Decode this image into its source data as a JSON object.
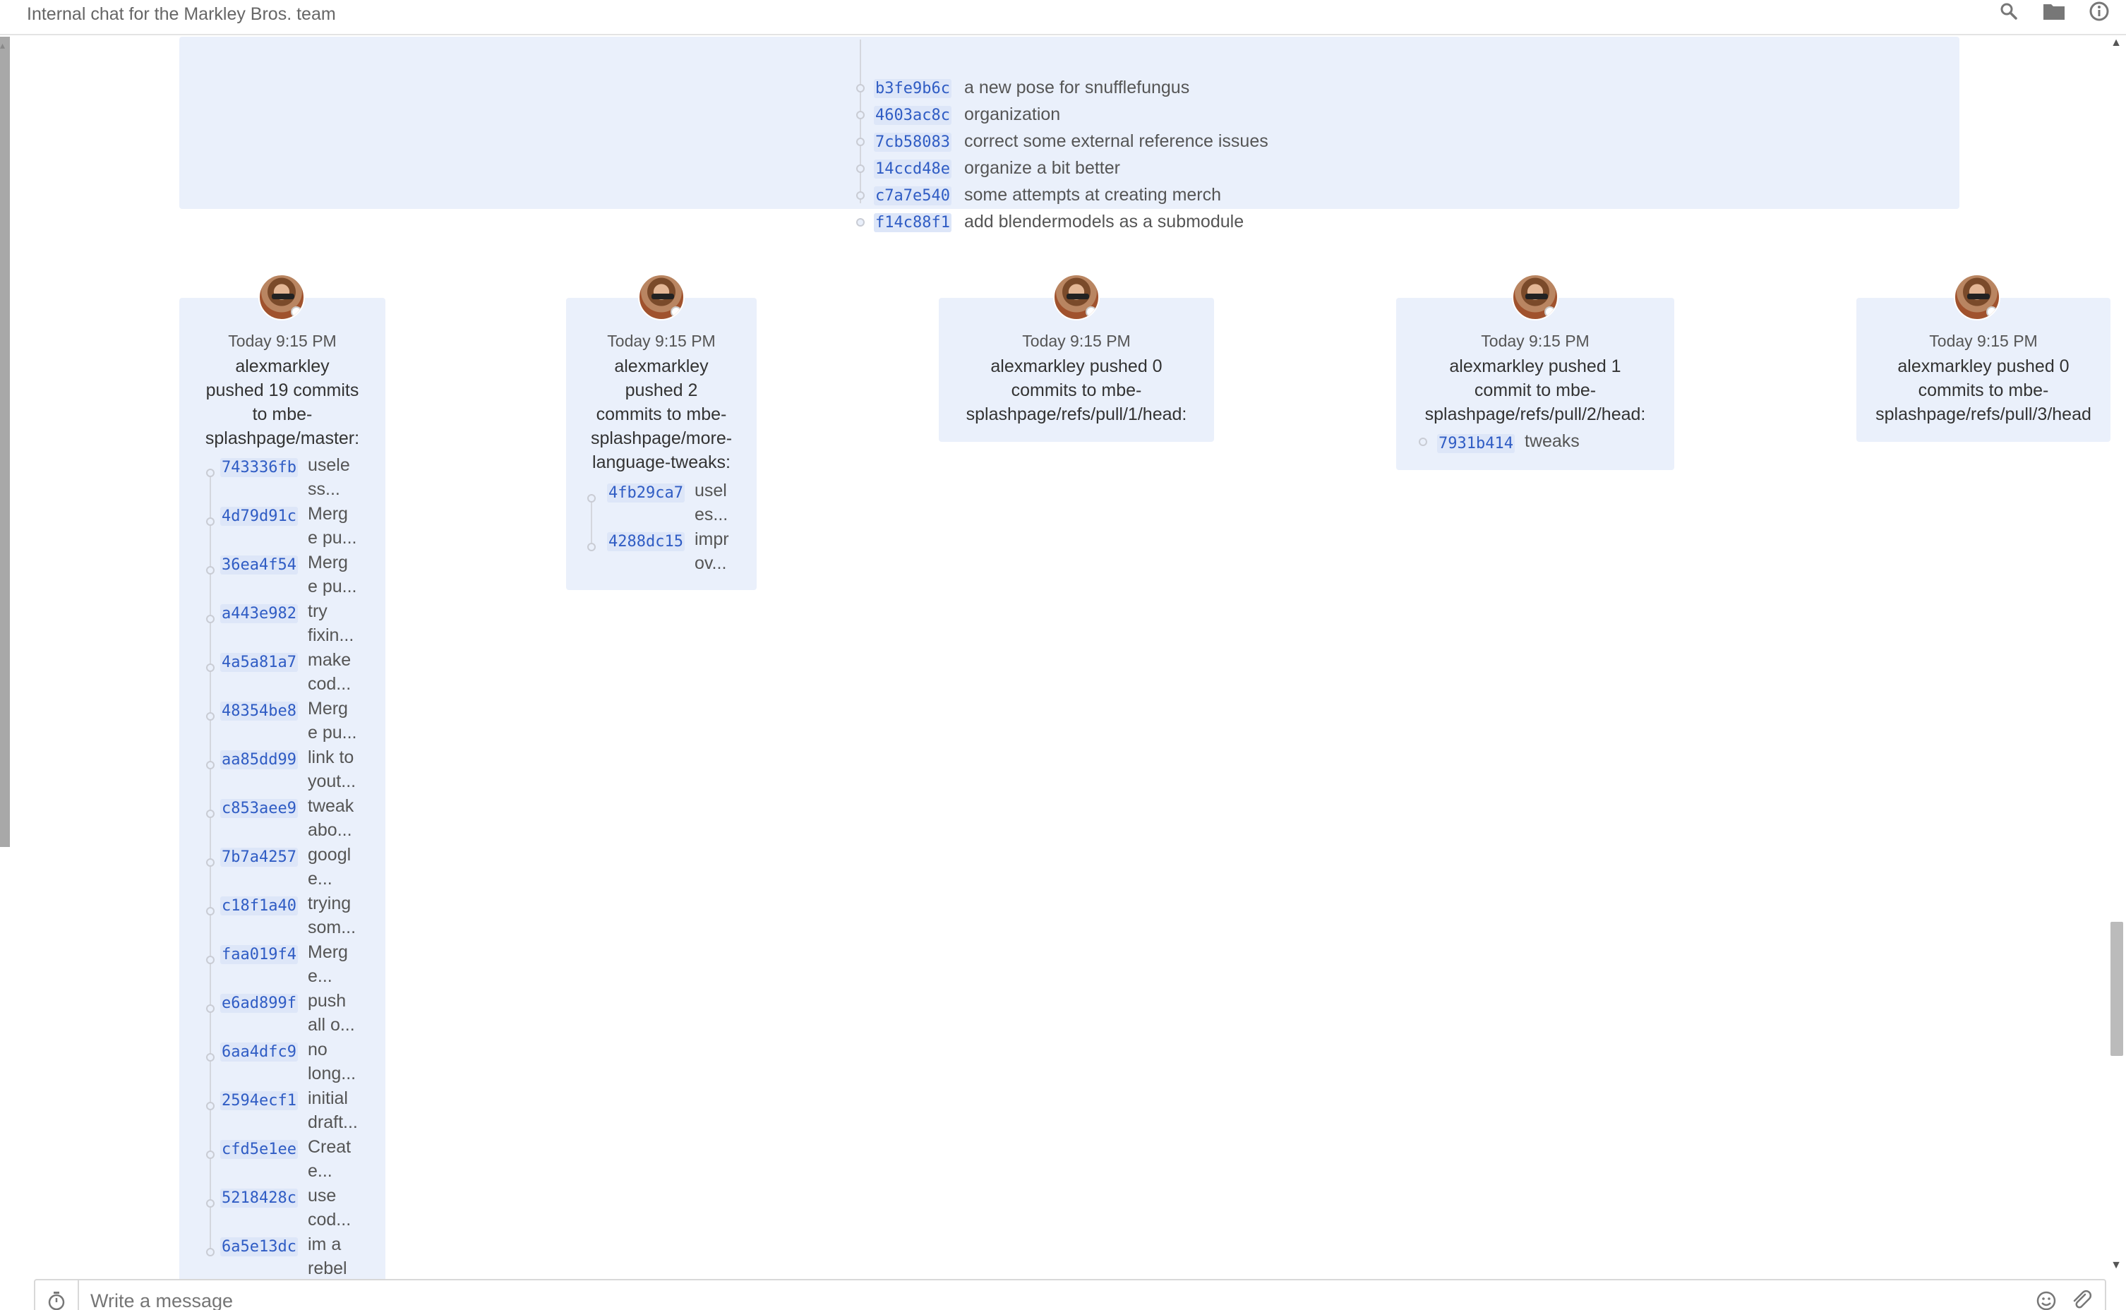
{
  "header": {
    "subtitle": "Internal chat for the Markley Bros. team",
    "icons": [
      "search-icon",
      "folder-icon",
      "info-icon"
    ]
  },
  "top_panel": {
    "commits": [
      {
        "hash": "b3fe9b6c",
        "message": "a new pose for snufflefungus"
      },
      {
        "hash": "4603ac8c",
        "message": "organization"
      },
      {
        "hash": "7cb58083",
        "message": "correct some external reference issues"
      },
      {
        "hash": "14ccd48e",
        "message": "organize a bit better"
      },
      {
        "hash": "c7a7e540",
        "message": "some attempts at creating merch"
      },
      {
        "hash": "f14c88f1",
        "message": "add blendermodels as a submodule"
      }
    ]
  },
  "events": [
    {
      "time": "Today 9:15 PM",
      "summary_lines": [
        "alexmarkley",
        "pushed 19 commits",
        "to mbe-",
        "splashpage/master:"
      ],
      "commits": [
        {
          "hash": "743336fb",
          "msg_lines": [
            "usele",
            "ss..."
          ]
        },
        {
          "hash": "4d79d91c",
          "msg_lines": [
            "Merg",
            "e pu..."
          ]
        },
        {
          "hash": "36ea4f54",
          "msg_lines": [
            "Merg",
            "e pu..."
          ]
        },
        {
          "hash": "a443e982",
          "msg_lines": [
            "try",
            "fixin..."
          ]
        },
        {
          "hash": "4a5a81a7",
          "msg_lines": [
            "make",
            "cod..."
          ]
        },
        {
          "hash": "48354be8",
          "msg_lines": [
            "Merg",
            "e pu..."
          ]
        },
        {
          "hash": "aa85dd99",
          "msg_lines": [
            "link to",
            "yout..."
          ]
        },
        {
          "hash": "c853aee9",
          "msg_lines": [
            "tweak",
            "abo..."
          ]
        },
        {
          "hash": "7b7a4257",
          "msg_lines": [
            "googl",
            "e..."
          ]
        },
        {
          "hash": "c18f1a40",
          "msg_lines": [
            "trying",
            "som..."
          ]
        },
        {
          "hash": "faa019f4",
          "msg_lines": [
            "Merg",
            "e..."
          ]
        },
        {
          "hash": "e6ad899f",
          "msg_lines": [
            "push",
            "all o..."
          ]
        },
        {
          "hash": "6aa4dfc9",
          "msg_lines": [
            "no",
            "long..."
          ]
        },
        {
          "hash": "2594ecf1",
          "msg_lines": [
            "initial",
            "draft..."
          ]
        },
        {
          "hash": "cfd5e1ee",
          "msg_lines": [
            "Creat",
            "e..."
          ]
        },
        {
          "hash": "5218428c",
          "msg_lines": [
            "use",
            "cod..."
          ]
        },
        {
          "hash": "6a5e13dc",
          "msg_lines": [
            "im a",
            "rebel"
          ]
        }
      ]
    },
    {
      "time": "Today 9:15 PM",
      "summary_lines": [
        "alexmarkley",
        "pushed 2",
        "commits to mbe-",
        "splashpage/more-",
        "language-tweaks:"
      ],
      "commits": [
        {
          "hash": "4fb29ca7",
          "msg_lines": [
            "usel",
            "es..."
          ]
        },
        {
          "hash": "4288dc15",
          "msg_lines": [
            "impr",
            "ov..."
          ]
        }
      ]
    },
    {
      "time": "Today 9:15 PM",
      "summary_lines": [
        "alexmarkley pushed 0",
        "commits to mbe-",
        "splashpage/refs/pull/1/head:"
      ],
      "commits": []
    },
    {
      "time": "Today 9:15 PM",
      "summary_lines": [
        "alexmarkley pushed 1",
        "commit to mbe-",
        "splashpage/refs/pull/2/head:"
      ],
      "commits": [
        {
          "hash": "7931b414",
          "msg_lines": [
            "tweaks"
          ]
        }
      ]
    },
    {
      "time": "Today 9:15 PM",
      "summary_lines": [
        "alexmarkley pushed 0",
        "commits to mbe-",
        "splashpage/refs/pull/3/head"
      ],
      "commits": []
    }
  ],
  "composer": {
    "placeholder": "Write a message",
    "icons": [
      "timer-icon",
      "emoji-icon",
      "attach-icon"
    ]
  },
  "colors": {
    "panel_bg": "#eaf0fb",
    "hash_text": "#2f5cc4",
    "hash_bg": "#dde6f8"
  }
}
